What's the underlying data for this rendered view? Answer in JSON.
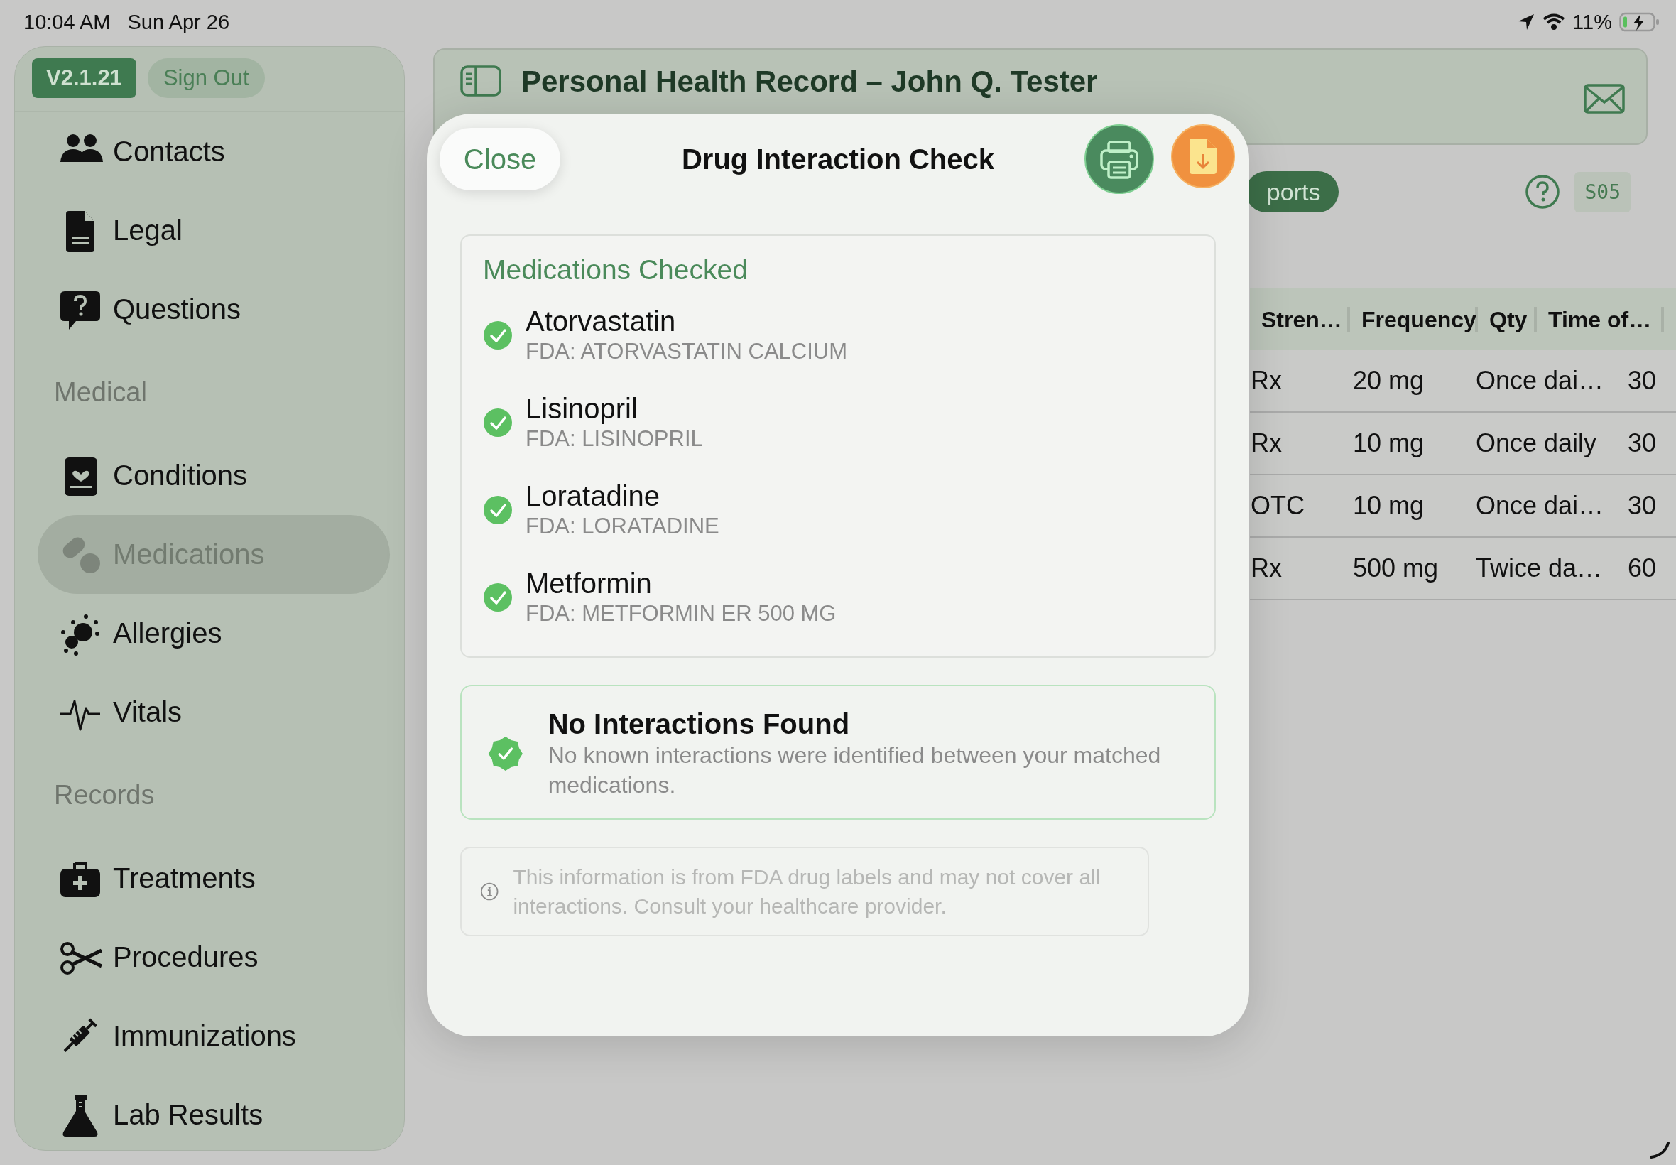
{
  "status_bar": {
    "time": "10:04 AM",
    "date": "Sun Apr 26",
    "battery": "11%"
  },
  "sidebar": {
    "version": "V2.1.21",
    "sign_out": "Sign Out",
    "groups": [
      {
        "items": [
          {
            "label": "Contacts",
            "selected": false
          },
          {
            "label": "Legal",
            "selected": false
          },
          {
            "label": "Questions",
            "selected": false
          }
        ]
      },
      {
        "heading": "Medical",
        "items": [
          {
            "label": "Conditions",
            "selected": false
          },
          {
            "label": "Medications",
            "selected": true
          },
          {
            "label": "Allergies",
            "selected": false
          },
          {
            "label": "Vitals",
            "selected": false
          }
        ]
      },
      {
        "heading": "Records",
        "items": [
          {
            "label": "Treatments",
            "selected": false
          },
          {
            "label": "Procedures",
            "selected": false
          },
          {
            "label": "Immunizations",
            "selected": false
          },
          {
            "label": "Lab Results",
            "selected": false
          }
        ]
      }
    ]
  },
  "header": {
    "title": "Personal Health Record – John Q. Tester"
  },
  "toolbar": {
    "reports_button": "ports",
    "code": "S05"
  },
  "table": {
    "columns": [
      "Stren…",
      "Frequency",
      "Qty",
      "Time of…"
    ],
    "rows": [
      [
        "Rx",
        "20 mg",
        "Once dai…",
        "30"
      ],
      [
        "Rx",
        "10 mg",
        "Once daily",
        "30"
      ],
      [
        "OTC",
        "10 mg",
        "Once dai…",
        "30"
      ],
      [
        "Rx",
        "500 mg",
        "Twice da…",
        "60"
      ]
    ]
  },
  "modal": {
    "close": "Close",
    "title": "Drug Interaction Check",
    "medications_heading": "Medications Checked",
    "medications": [
      {
        "name": "Atorvastatin",
        "fda": "FDA: ATORVASTATIN CALCIUM"
      },
      {
        "name": "Lisinopril",
        "fda": "FDA: LISINOPRIL"
      },
      {
        "name": "Loratadine",
        "fda": "FDA: LORATADINE"
      },
      {
        "name": "Metformin",
        "fda": "FDA: METFORMIN ER 500 MG"
      }
    ],
    "result": {
      "title": "No Interactions Found",
      "message": "No known interactions were identified between your matched medications."
    },
    "disclaimer": "This information is from FDA drug labels and may not cover all interactions. Consult your healthcare provider."
  }
}
